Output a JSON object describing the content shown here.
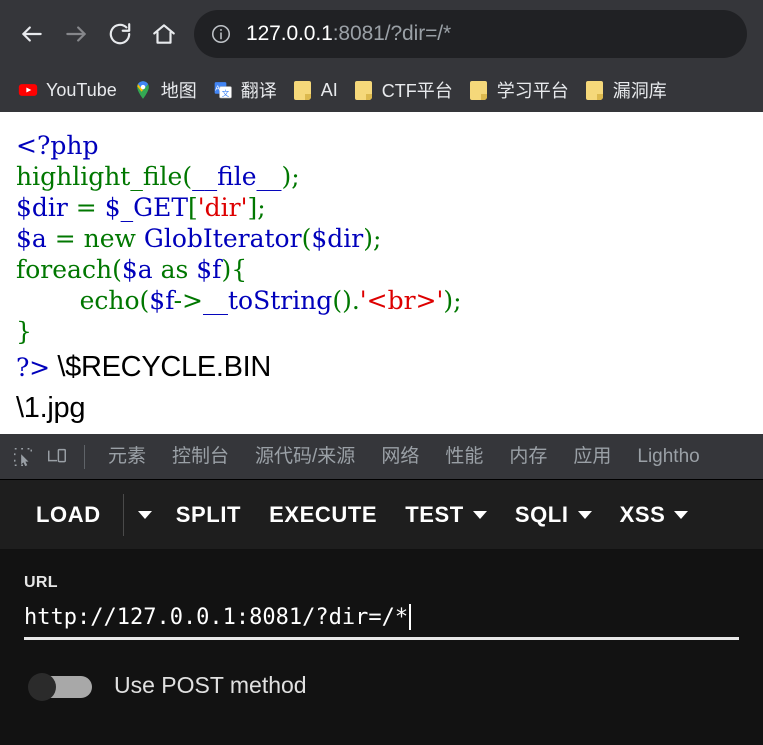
{
  "browser": {
    "nav": {
      "back_label": "Back",
      "forward_label": "Forward",
      "reload_label": "Reload",
      "home_label": "Home"
    },
    "omnibox": {
      "site_info_icon": "info-circle-icon",
      "host": "127.0.0.1",
      "rest": ":8081/?dir=/*",
      "full_url": "127.0.0.1:8081/?dir=/*"
    },
    "bookmarks": [
      {
        "label": "YouTube",
        "icon": "youtube-icon"
      },
      {
        "label": "地图",
        "icon": "google-maps-icon"
      },
      {
        "label": "翻译",
        "icon": "google-translate-icon"
      },
      {
        "label": "AI",
        "icon": "folder-icon"
      },
      {
        "label": "CTF平台",
        "icon": "folder-icon"
      },
      {
        "label": "学习平台",
        "icon": "folder-icon"
      },
      {
        "label": "漏洞库",
        "icon": "folder-icon"
      }
    ]
  },
  "page_content": {
    "code_lines": [
      {
        "tokens": [
          {
            "t": "<?php",
            "c": "default"
          }
        ]
      },
      {
        "tokens": [
          {
            "t": "highlight_file",
            "c": "keyword"
          },
          {
            "t": "(",
            "c": "keyword"
          },
          {
            "t": "__file__",
            "c": "default"
          },
          {
            "t": ");",
            "c": "keyword"
          }
        ]
      },
      {
        "tokens": [
          {
            "t": "$dir",
            "c": "default"
          },
          {
            "t": " = ",
            "c": "keyword"
          },
          {
            "t": "$_GET",
            "c": "default"
          },
          {
            "t": "[",
            "c": "keyword"
          },
          {
            "t": "'dir'",
            "c": "string"
          },
          {
            "t": "];",
            "c": "keyword"
          }
        ]
      },
      {
        "tokens": [
          {
            "t": "$a",
            "c": "default"
          },
          {
            "t": " = ",
            "c": "keyword"
          },
          {
            "t": "new",
            "c": "keyword"
          },
          {
            "t": " ",
            "c": "keyword"
          },
          {
            "t": "GlobIterator",
            "c": "default"
          },
          {
            "t": "(",
            "c": "keyword"
          },
          {
            "t": "$dir",
            "c": "default"
          },
          {
            "t": ");",
            "c": "keyword"
          }
        ]
      },
      {
        "tokens": [
          {
            "t": "foreach",
            "c": "keyword"
          },
          {
            "t": "(",
            "c": "keyword"
          },
          {
            "t": "$a",
            "c": "default"
          },
          {
            "t": " as ",
            "c": "keyword"
          },
          {
            "t": "$f",
            "c": "default"
          },
          {
            "t": "){",
            "c": "keyword"
          }
        ]
      },
      {
        "tokens": [
          {
            "t": "        ",
            "c": "keyword"
          },
          {
            "t": "echo",
            "c": "keyword"
          },
          {
            "t": "(",
            "c": "keyword"
          },
          {
            "t": "$f",
            "c": "default"
          },
          {
            "t": "->",
            "c": "keyword"
          },
          {
            "t": "__toString",
            "c": "default"
          },
          {
            "t": "().",
            "c": "keyword"
          },
          {
            "t": "'<br>'",
            "c": "string"
          },
          {
            "t": ");",
            "c": "keyword"
          }
        ]
      },
      {
        "tokens": [
          {
            "t": "}",
            "c": "keyword"
          }
        ]
      }
    ],
    "php_close_tag": "?>",
    "glob_results": [
      "\\$RECYCLE.BIN",
      "\\1.jpg"
    ]
  },
  "devtools": {
    "icons": [
      {
        "name": "inspect-element-icon",
        "label": "Inspect element"
      },
      {
        "name": "device-toolbar-icon",
        "label": "Toggle device toolbar"
      }
    ],
    "tabs": [
      {
        "label": "元素"
      },
      {
        "label": "控制台"
      },
      {
        "label": "源代码/来源"
      },
      {
        "label": "网络"
      },
      {
        "label": "性能"
      },
      {
        "label": "内存"
      },
      {
        "label": "应用"
      },
      {
        "label": "Lightho"
      }
    ]
  },
  "hackbar": {
    "buttons": [
      {
        "label": "LOAD",
        "has_caret": false,
        "split_caret": true
      },
      {
        "label": "SPLIT",
        "has_caret": false,
        "split_caret": false
      },
      {
        "label": "EXECUTE",
        "has_caret": false,
        "split_caret": false
      },
      {
        "label": "TEST",
        "has_caret": true,
        "split_caret": false
      },
      {
        "label": "SQLI",
        "has_caret": true,
        "split_caret": false
      },
      {
        "label": "XSS",
        "has_caret": true,
        "split_caret": false
      }
    ],
    "url_field": {
      "label": "URL",
      "value": "http://127.0.0.1:8081/?dir=/*",
      "placeholder": "URL"
    },
    "post_toggle": {
      "label": "Use POST method",
      "enabled": false
    }
  },
  "colors": {
    "chrome_bg": "#35363a",
    "omnibox_bg": "#202124",
    "devtools_bg": "#202124",
    "hackbar_toolbar_bg": "#1e1e1e",
    "hackbar_body_bg": "#121212",
    "php_default": "#0000bb",
    "php_keyword": "#007700",
    "php_string": "#dd0000",
    "folder_icon": "#f5d87a",
    "youtube_red": "#ff0000"
  }
}
